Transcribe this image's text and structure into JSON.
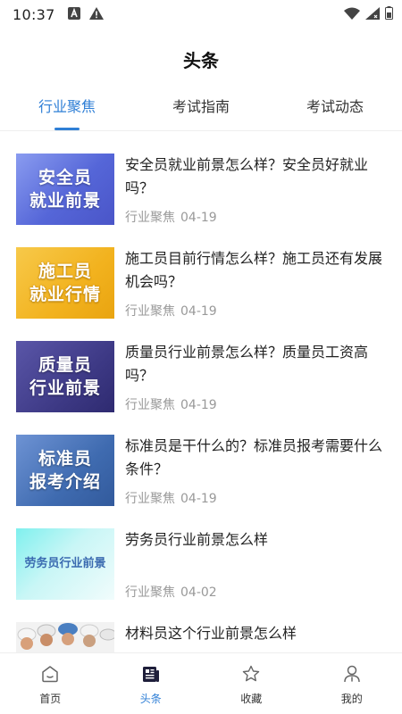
{
  "status_bar": {
    "time": "10:37",
    "left_icons": [
      "notification-a-icon",
      "warning-icon"
    ],
    "right_icons": [
      "wifi-icon",
      "signal-icon",
      "battery-icon"
    ]
  },
  "header": {
    "title": "头条"
  },
  "tabs": [
    {
      "label": "行业聚焦",
      "active": true
    },
    {
      "label": "考试指南",
      "active": false
    },
    {
      "label": "考试动态",
      "active": false
    }
  ],
  "articles": [
    {
      "title": "安全员就业前景怎么样？安全员好就业吗？",
      "category": "行业聚焦",
      "date": "04-19",
      "thumb_text": [
        "安全员",
        "就业前景"
      ],
      "thumb_colors": {
        "background": "#5f6fe0",
        "text": "#ffffff"
      }
    },
    {
      "title": "施工员目前行情怎么样？施工员还有发展机会吗？",
      "category": "行业聚焦",
      "date": "04-19",
      "thumb_text": [
        "施工员",
        "就业行情"
      ],
      "thumb_colors": {
        "background": "#f2b21e",
        "text": "#ffffff"
      }
    },
    {
      "title": "质量员行业前景怎么样？质量员工资高吗？",
      "category": "行业聚焦",
      "date": "04-19",
      "thumb_text": [
        "质量员",
        "行业前景"
      ],
      "thumb_colors": {
        "background": "#3e3a86",
        "text": "#ffffff"
      }
    },
    {
      "title": "标准员是干什么的？标准员报考需要什么条件？",
      "category": "行业聚焦",
      "date": "04-19",
      "thumb_text": [
        "标准员",
        "报考介绍"
      ],
      "thumb_colors": {
        "background": "#3f6bb0",
        "text": "#ffffff"
      }
    },
    {
      "title": "劳务员行业前景怎么样",
      "category": "行业聚焦",
      "date": "04-02",
      "thumb_text": [
        "劳务员行业前景"
      ],
      "thumb_colors": {
        "background": "#bff3f3",
        "text": "#3a6ab0"
      }
    },
    {
      "title": "材料员这个行业前景怎么样",
      "category": "",
      "date": "",
      "thumb_text": [],
      "thumb_colors": {
        "background": "#f3f3f3",
        "text": "#333333"
      }
    }
  ],
  "bottom_nav": [
    {
      "label": "首页",
      "icon": "home-icon",
      "active": false
    },
    {
      "label": "头条",
      "icon": "news-icon",
      "active": true
    },
    {
      "label": "收藏",
      "icon": "star-icon",
      "active": false
    },
    {
      "label": "我的",
      "icon": "user-icon",
      "active": false
    }
  ],
  "colors": {
    "accent": "#2f7fd6",
    "meta_text": "#999999",
    "divider": "#eeeeee"
  }
}
